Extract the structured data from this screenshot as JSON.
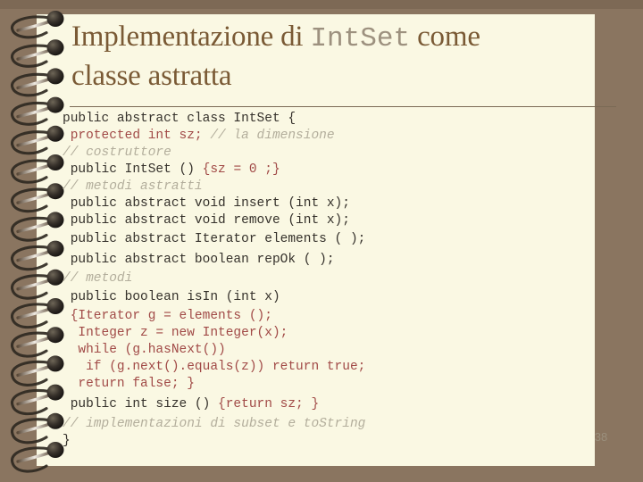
{
  "slide": {
    "background_color": "#8a7560",
    "page_color": "#faf8e3",
    "page_number": "38"
  },
  "title": {
    "part1": "Implementazione di ",
    "code_word": "IntSet",
    "part2": " come",
    "line2": "classe astratta",
    "color": "#7a5a35",
    "code_word_color": "#9d917f"
  },
  "code": {
    "dark_color": "#35312b",
    "red_color": "#a14a47",
    "comment_color": "#b3ae9c",
    "lines": [
      {
        "segments": [
          {
            "text": "public abstract class IntSet {",
            "style": "dark"
          }
        ]
      },
      {
        "segments": [
          {
            "text": " protected int sz; ",
            "style": "red"
          },
          {
            "text": "// la dimensione",
            "style": "comment"
          }
        ]
      },
      {
        "segments": [
          {
            "text": "// costruttore",
            "style": "comment"
          }
        ]
      },
      {
        "segments": [
          {
            "text": " public IntSet () ",
            "style": "dark"
          },
          {
            "text": "{sz = 0 ;}",
            "style": "red"
          }
        ]
      },
      {
        "segments": [
          {
            "text": "// metodi astratti",
            "style": "comment"
          }
        ]
      },
      {
        "segments": [
          {
            "text": " public abstract void insert (int x);",
            "style": "dark"
          }
        ]
      },
      {
        "segments": [
          {
            "text": " public abstract void remove (int x);",
            "style": "dark"
          }
        ]
      },
      {
        "segments": [
          {
            "text": " public abstract Iterator elements ( );",
            "style": "dark"
          }
        ],
        "spacing": "gap"
      },
      {
        "segments": [
          {
            "text": " public abstract boolean repOk ( );",
            "style": "dark"
          }
        ],
        "spacing": "gap"
      },
      {
        "segments": [
          {
            "text": "// metodi",
            "style": "comment"
          }
        ]
      },
      {
        "segments": [
          {
            "text": " public boolean isIn (int x)",
            "style": "dark"
          }
        ],
        "spacing": "gap"
      },
      {
        "segments": [
          {
            "text": " {Iterator g = elements ();",
            "style": "red"
          }
        ]
      },
      {
        "segments": [
          {
            "text": "  Integer z = new Integer(x);",
            "style": "red"
          }
        ]
      },
      {
        "segments": [
          {
            "text": "  while (g.hasNext())",
            "style": "red"
          }
        ]
      },
      {
        "segments": [
          {
            "text": "   if (g.next().equals(z)) return true;",
            "style": "red"
          }
        ]
      },
      {
        "segments": [
          {
            "text": "  return false; }",
            "style": "red"
          }
        ]
      },
      {
        "segments": [
          {
            "text": " public int size () ",
            "style": "dark"
          },
          {
            "text": "{return sz; }",
            "style": "red"
          }
        ],
        "spacing": "gap2"
      },
      {
        "segments": [
          {
            "text": "// implementazioni di subset e toString",
            "style": "comment"
          }
        ]
      },
      {
        "segments": [
          {
            "text": "}",
            "style": "dark"
          }
        ]
      }
    ]
  },
  "spiral": {
    "ring_count": 16,
    "description": "spiral-notebook-binding"
  }
}
